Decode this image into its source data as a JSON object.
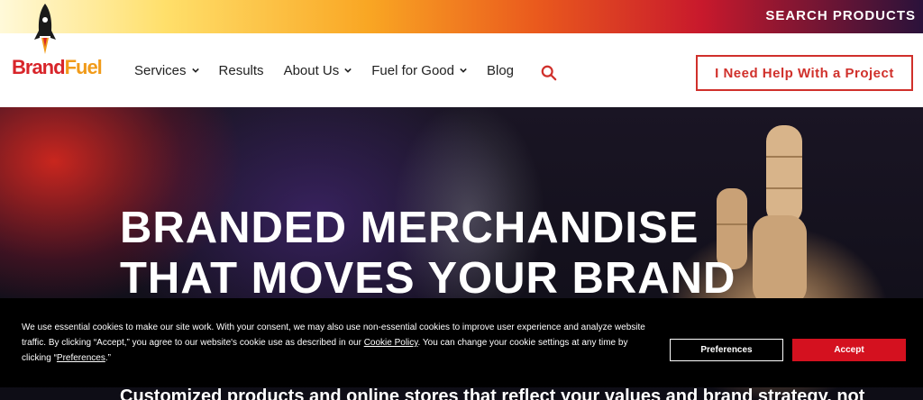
{
  "topbar": {
    "search_products": "SEARCH PRODUCTS"
  },
  "brand": {
    "logo_part1": "Brand",
    "logo_part2": "Fuel"
  },
  "nav": {
    "items": [
      {
        "label": "Services",
        "has_dropdown": true
      },
      {
        "label": "Results",
        "has_dropdown": false
      },
      {
        "label": "About Us",
        "has_dropdown": true
      },
      {
        "label": "Fuel for Good",
        "has_dropdown": true
      },
      {
        "label": "Blog",
        "has_dropdown": false
      }
    ],
    "cta_label": "I Need Help With a Project"
  },
  "hero": {
    "title_line1": "BRANDED MERCHANDISE",
    "title_line2": "THAT MOVES YOUR BRAND",
    "subtitle": "Customized products and online stores that reflect your values and brand strategy, not"
  },
  "cookie": {
    "text_part1": "We use essential cookies to make our site work. With your consent, we may also use non-essential cookies to improve user experience and analyze website traffic. By clicking “Accept,” you agree to our website's cookie use as described in our ",
    "cookie_policy_link": "Cookie Policy",
    "text_part2": ". You can change your cookie settings at any time by clicking “",
    "preferences_link": "Preferences",
    "text_part3": ".”",
    "preferences_button": "Preferences",
    "accept_button": "Accept"
  },
  "colors": {
    "accent_red": "#d0302b",
    "accept_red": "#d4111f",
    "logo_orange": "#f19b1a"
  }
}
